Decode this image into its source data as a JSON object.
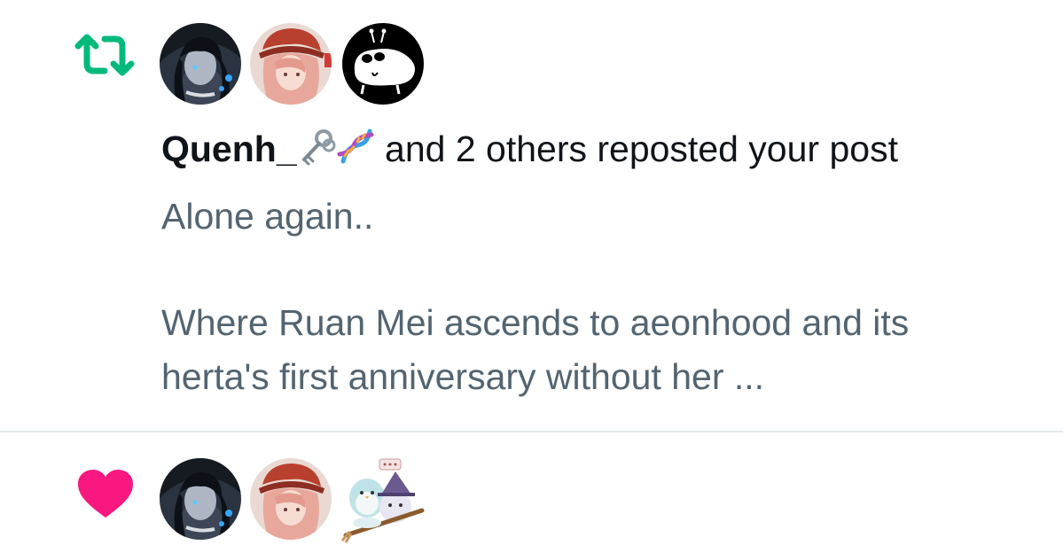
{
  "repost_notification": {
    "icon": "repost-icon",
    "icon_color": "#00ba7c",
    "avatars": [
      "avatar-dark-haired-character",
      "avatar-pink-haired-character-red-hat",
      "avatar-white-creature-black-background"
    ],
    "user_name": "Quenh_",
    "user_name_emojis": [
      "key-emoji",
      "dna-emoji"
    ],
    "action_text": " and 2 others reposted your post",
    "post_preview": {
      "line1": "Alone again..",
      "line2": "Where Ruan Mei ascends to aeonhood and its",
      "line3": "herta's first anniversary without her ..."
    }
  },
  "like_notification": {
    "icon": "heart-icon",
    "icon_color": "#f91880",
    "avatars": [
      "avatar-dark-haired-character",
      "avatar-pink-haired-character-red-hat",
      "avatar-bird-and-witch-sticker"
    ]
  },
  "colors": {
    "primary_text": "#0f1419",
    "secondary_text": "#536471",
    "divider": "#e3e8ec"
  }
}
